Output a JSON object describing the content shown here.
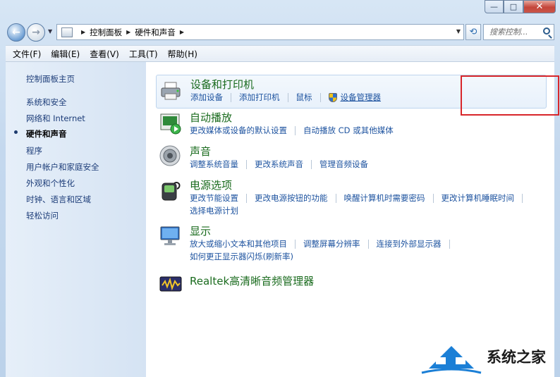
{
  "window": {
    "minimize": "—",
    "maximize": "□",
    "close": "✕"
  },
  "nav": {
    "back": "←",
    "forward": "→",
    "breadcrumbs": [
      "控制面板",
      "硬件和声音"
    ],
    "search_placeholder": "搜索控制..."
  },
  "menu": [
    "文件(F)",
    "编辑(E)",
    "查看(V)",
    "工具(T)",
    "帮助(H)"
  ],
  "sidebar": {
    "items": [
      "控制面板主页",
      "系统和安全",
      "网络和 Internet",
      "硬件和声音",
      "程序",
      "用户帐户和家庭安全",
      "外观和个性化",
      "时钟、语言和区域",
      "轻松访问"
    ],
    "current_index": 3
  },
  "categories": [
    {
      "title": "设备和打印机",
      "icon": "printer-icon",
      "links": [
        [
          "添加设备",
          "添加打印机",
          "鼠标",
          "设备管理器"
        ]
      ]
    },
    {
      "title": "自动播放",
      "icon": "autoplay-icon",
      "links": [
        [
          "更改媒体或设备的默认设置",
          "自动播放 CD 或其他媒体"
        ]
      ]
    },
    {
      "title": "声音",
      "icon": "speaker-icon",
      "links": [
        [
          "调整系统音量",
          "更改系统声音",
          "管理音频设备"
        ]
      ]
    },
    {
      "title": "电源选项",
      "icon": "power-icon",
      "links": [
        [
          "更改节能设置",
          "更改电源按钮的功能",
          "唤醒计算机时需要密码",
          "更改计算机睡眠时间"
        ],
        [
          "选择电源计划"
        ]
      ]
    },
    {
      "title": "显示",
      "icon": "display-icon",
      "links": [
        [
          "放大或缩小文本和其他项目",
          "调整屏幕分辨率",
          "连接到外部显示器"
        ],
        [
          "如何更正显示器闪烁(刷新率)"
        ]
      ]
    },
    {
      "title": "Realtek高清晰音频管理器",
      "icon": "realtek-icon",
      "links": []
    }
  ],
  "watermark": "系统之家",
  "colors": {
    "category_title": "#1a6b1e",
    "link": "#1f54a0",
    "highlight_box": "#d8262a"
  }
}
